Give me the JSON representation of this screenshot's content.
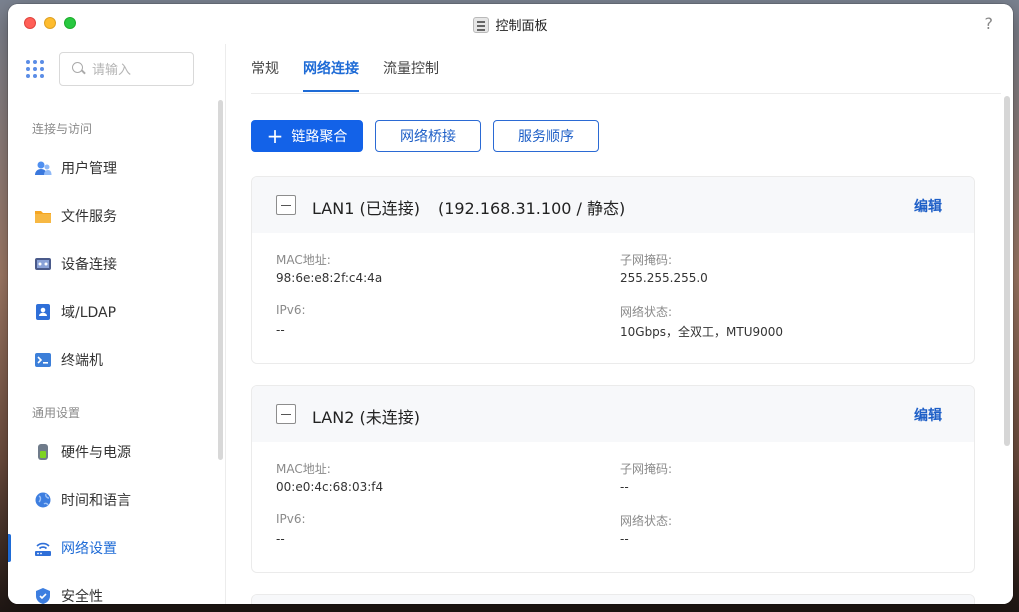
{
  "window": {
    "title": "控制面板",
    "help": "?"
  },
  "sidebar": {
    "search_placeholder": "请输入",
    "sections": [
      {
        "label": "连接与访问"
      },
      {
        "label": "通用设置"
      }
    ],
    "items": [
      {
        "label": "用户管理",
        "icon": "users-icon"
      },
      {
        "label": "文件服务",
        "icon": "folder-icon"
      },
      {
        "label": "设备连接",
        "icon": "device-icon"
      },
      {
        "label": "域/LDAP",
        "icon": "ldap-icon"
      },
      {
        "label": "终端机",
        "icon": "terminal-icon"
      },
      {
        "label": "硬件与电源",
        "icon": "hardware-icon"
      },
      {
        "label": "时间和语言",
        "icon": "globe-icon"
      },
      {
        "label": "网络设置",
        "icon": "network-icon",
        "active": true
      },
      {
        "label": "安全性",
        "icon": "shield-icon"
      }
    ]
  },
  "tabs": [
    {
      "label": "常规"
    },
    {
      "label": "网络连接",
      "active": true
    },
    {
      "label": "流量控制"
    }
  ],
  "toolbar": {
    "link_aggregation": "链路聚合",
    "network_bridge": "网络桥接",
    "service_order": "服务顺序"
  },
  "interfaces": [
    {
      "name": "LAN1 (已连接)",
      "ip": "(192.168.31.100 / 静态)",
      "edit": "编辑",
      "mac_label": "MAC地址:",
      "mac": "98:6e:e8:2f:c4:4a",
      "subnet_label": "子网掩码:",
      "subnet": "255.255.255.0",
      "ipv6_label": "IPv6:",
      "ipv6": "--",
      "status_label": "网络状态:",
      "status": "10Gbps，全双工，MTU9000"
    },
    {
      "name": "LAN2 (未连接)",
      "ip": "",
      "edit": "编辑",
      "mac_label": "MAC地址:",
      "mac": "00:e0:4c:68:03:f4",
      "subnet_label": "子网掩码:",
      "subnet": "--",
      "ipv6_label": "IPv6:",
      "ipv6": "--",
      "status_label": "网络状态:",
      "status": "--"
    }
  ],
  "colors": {
    "accent": "#1362e8",
    "link": "#1e5fc7"
  }
}
